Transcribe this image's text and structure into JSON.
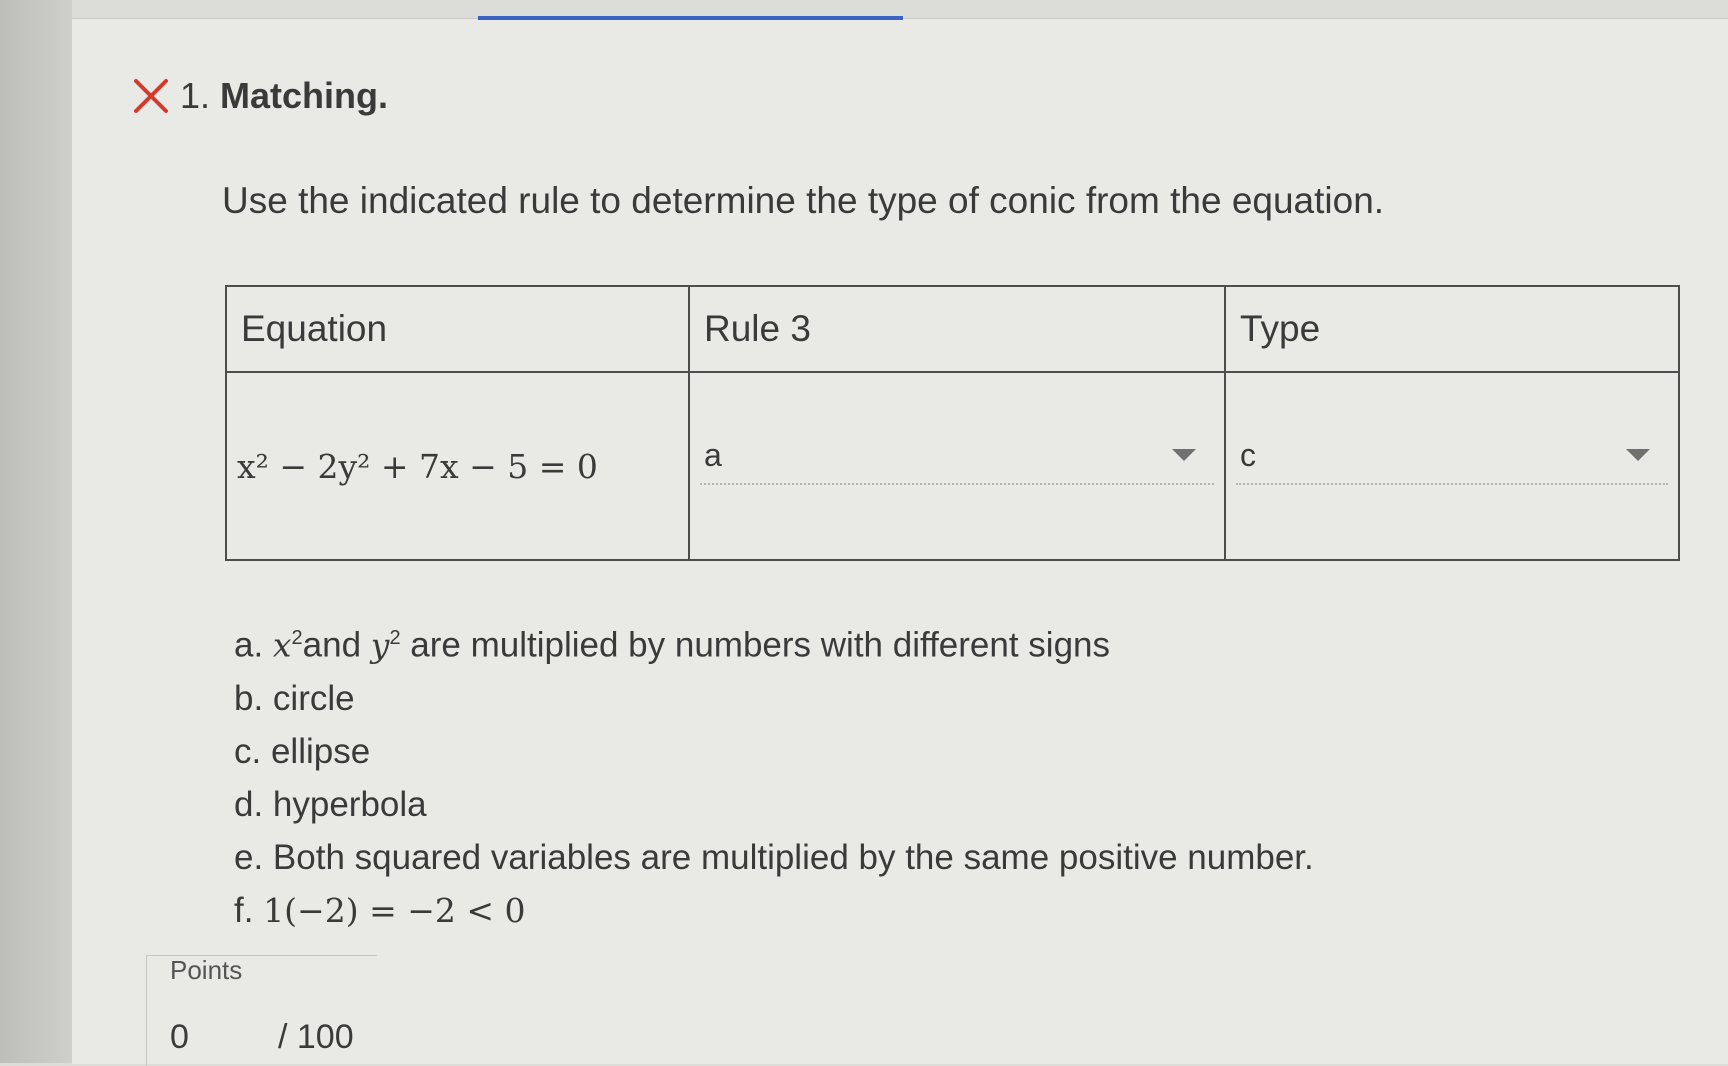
{
  "question": {
    "status_icon": "x-icon",
    "status_color": "#d23b2b",
    "number": "1.",
    "type": "Matching.",
    "prompt": "Use the indicated rule to determine the type of conic from the equation."
  },
  "table": {
    "headers": [
      "Equation",
      "Rule 3",
      "Type"
    ],
    "row": {
      "equation": "x² − 2y² + 7x − 5 = 0",
      "rule_selected": "a",
      "type_selected": "c"
    }
  },
  "options": {
    "a_prefix": "a. ",
    "a_x": "x",
    "a_exp1": "2",
    "a_mid": "and ",
    "a_y": "y",
    "a_exp2": "2",
    "a_suffix": " are multiplied by numbers with different signs",
    "b": "b. circle",
    "c": "c. ellipse",
    "d": "d. hyperbola",
    "e": "e. Both squared variables are multiplied by the same positive number.",
    "f_prefix": "f. ",
    "f_math": "1(−2) = −2 < 0"
  },
  "points": {
    "label": "Points",
    "value": "0",
    "total": "/ 100"
  }
}
